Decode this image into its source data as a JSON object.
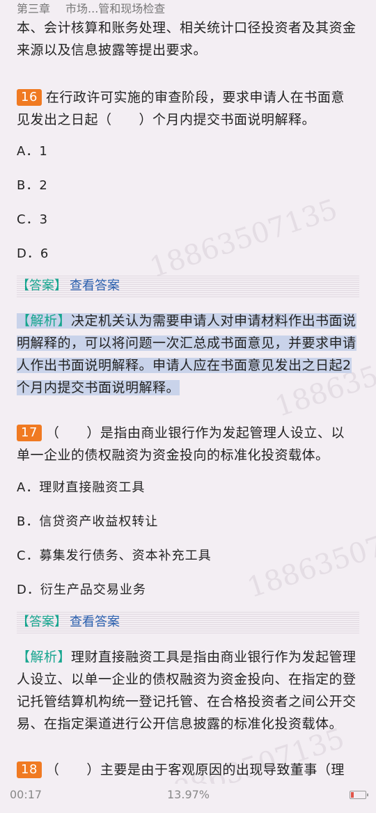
{
  "header": {
    "chapter": "第三章",
    "title": "市场...管和现场检查"
  },
  "intro_text": {
    "line1": "本、会计核算和账务处理、相关统计口径投资者及其资金",
    "line2": "来源以及信息披露等提出要求。"
  },
  "q16": {
    "num": "16",
    "line1": "在行政许可实施的审查阶段，要求申请人在书面意",
    "line2": "见发出之日起（　　）个月内提交书面说明解释。",
    "options": [
      "A．1",
      "B．2",
      "C．3",
      "D．6"
    ],
    "answer_tag": "【答案】",
    "answer_link": "查看答案",
    "analysis_tag": "【解析】",
    "analysis_l1": "决定机关认为需要申请人对申请材料作出书面说",
    "analysis_l2": "明解释的，可以将问题一次汇总成书面意见，并要求申请",
    "analysis_l3": "人作出书面说明解释。申请人应在书面意见发出之日起2",
    "analysis_l4": "个月内提交书面说明解释。"
  },
  "q17": {
    "num": "17",
    "line1": "（　　）是指由商业银行作为发起管理人设立、以",
    "line2": "单一企业的债权融资为资金投向的标准化投资载体。",
    "options": [
      "A．理财直接融资工具",
      "B．信贷资产收益权转让",
      "C．募集发行债务、资本补充工具",
      "D．衍生产品交易业务"
    ],
    "answer_tag": "【答案】",
    "answer_link": "查看答案",
    "analysis_tag": "【解析】",
    "analysis_l1": "理财直接融资工具是指由商业银行作为发起管理",
    "analysis_l2": "人设立、以单一企业的债权融资为资金投向、在指定的登",
    "analysis_l3": "记托管结算机构统一登记托管、在合格投资者之间公开交",
    "analysis_l4": "易、在指定渠道进行公开信息披露的标准化投资载体。"
  },
  "q18": {
    "num": "18",
    "line1": "（　　）主要是由于客观原因的出现导致董事（理"
  },
  "watermark": "18863507135",
  "status": {
    "time": "00:17",
    "progress": "13.97%"
  }
}
